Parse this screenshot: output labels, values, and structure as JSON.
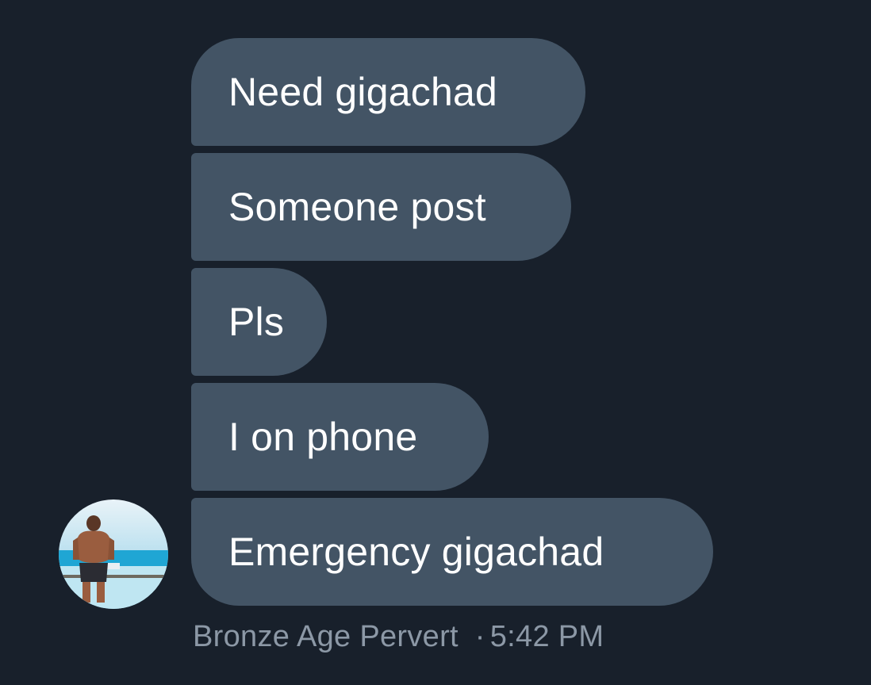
{
  "conversation": {
    "messages": [
      {
        "text": "Need gigachad"
      },
      {
        "text": "Someone post"
      },
      {
        "text": "Pls"
      },
      {
        "text": "I on phone"
      },
      {
        "text": "Emergency gigachad"
      }
    ],
    "sender": {
      "name": "Bronze Age Pervert",
      "avatar_icon": "avatar-image"
    },
    "separator": "·",
    "timestamp": "5:42 PM"
  },
  "colors": {
    "background": "#18202b",
    "bubble": "#435465",
    "meta_text": "#8c98a6"
  }
}
